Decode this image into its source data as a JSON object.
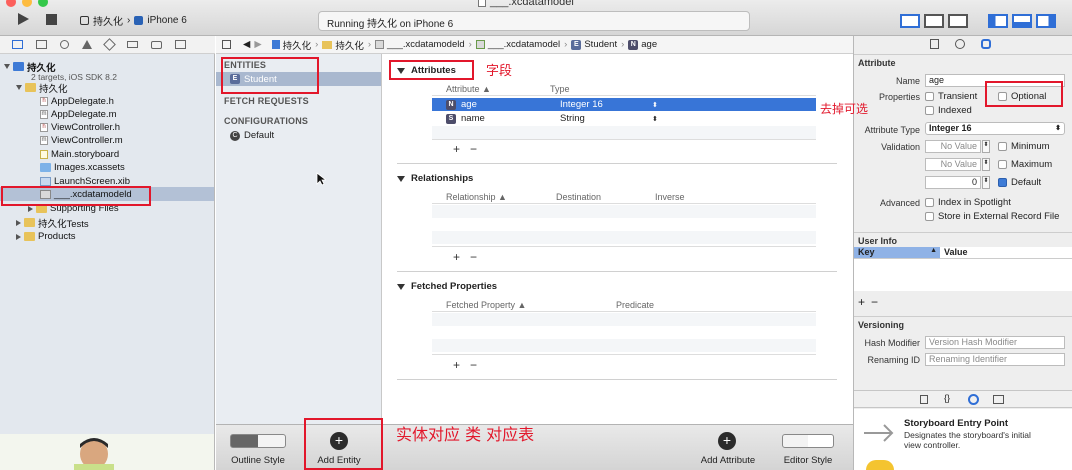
{
  "window": {
    "title": "___.xcdatamodel"
  },
  "toolbar": {
    "scheme": "持久化",
    "device": "iPhone 6",
    "status": "Running 持久化 on iPhone 6"
  },
  "navigator": {
    "project": "持久化",
    "project_sub": "2 targets, iOS SDK 8.2",
    "group": "持久化",
    "files": [
      "AppDelegate.h",
      "AppDelegate.m",
      "ViewController.h",
      "ViewController.m",
      "Main.storyboard",
      "Images.xcassets",
      "LaunchScreen.xib",
      "___.xcdatamodeld",
      "Supporting Files"
    ],
    "tests": "持久化Tests",
    "products": "Products"
  },
  "jumpbar": {
    "items": [
      "持久化",
      "持久化",
      "___.xcdatamodeld",
      "___.xcdatamodel",
      "Student",
      "age"
    ],
    "badges": [
      "E",
      "N"
    ]
  },
  "entities_panel": {
    "entities_header": "ENTITIES",
    "entity": "Student",
    "entity_badge": "E",
    "fetch_header": "FETCH REQUESTS",
    "config_header": "CONFIGURATIONS",
    "config": "Default",
    "config_badge": "C"
  },
  "editor": {
    "attributes_title": "Attributes",
    "attr_col1": "Attribute ▲",
    "attr_col2": "Type",
    "attributes": [
      {
        "badge": "N",
        "name": "age",
        "type": "Integer 16"
      },
      {
        "badge": "S",
        "name": "name",
        "type": "String"
      }
    ],
    "relationships_title": "Relationships",
    "rel_cols": [
      "Relationship ▲",
      "Destination",
      "Inverse"
    ],
    "fetched_title": "Fetched Properties",
    "fetched_cols": [
      "Fetched Property ▲",
      "Predicate"
    ],
    "plus": "+",
    "minus": "−"
  },
  "bottom": {
    "outline_style": "Outline Style",
    "add_entity": "Add Entity",
    "add_attribute": "Add Attribute",
    "editor_style": "Editor Style"
  },
  "inspector": {
    "section_attribute": "Attribute",
    "name_label": "Name",
    "name_value": "age",
    "properties_label": "Properties",
    "transient": "Transient",
    "optional": "Optional",
    "indexed": "Indexed",
    "type_label": "Attribute Type",
    "type_value": "Integer 16",
    "validation_label": "Validation",
    "no_value": "No Value",
    "minimum": "Minimum",
    "maximum": "Maximum",
    "default_value": "0",
    "default_label": "Default",
    "advanced_label": "Advanced",
    "index_spotlight": "Index in Spotlight",
    "store_external": "Store in External Record File",
    "user_info": "User Info",
    "key_col": "Key",
    "value_col": "Value",
    "versioning": "Versioning",
    "hash_label": "Hash Modifier",
    "hash_placeholder": "Version Hash Modifier",
    "renaming_label": "Renaming ID",
    "renaming_placeholder": "Renaming Identifier",
    "library_title": "Storyboard Entry Point",
    "library_desc_1": "Designates the storyboard's initial",
    "library_desc_2": "view controller."
  },
  "annotations": {
    "field": "字段",
    "optional_note": "去掉可选",
    "entity_note": "实体对应 类 对应表"
  },
  "colors": {
    "annotation": "#e2172b",
    "selection": "#3875d7",
    "sidebar_selection": "#b3c1d6"
  }
}
